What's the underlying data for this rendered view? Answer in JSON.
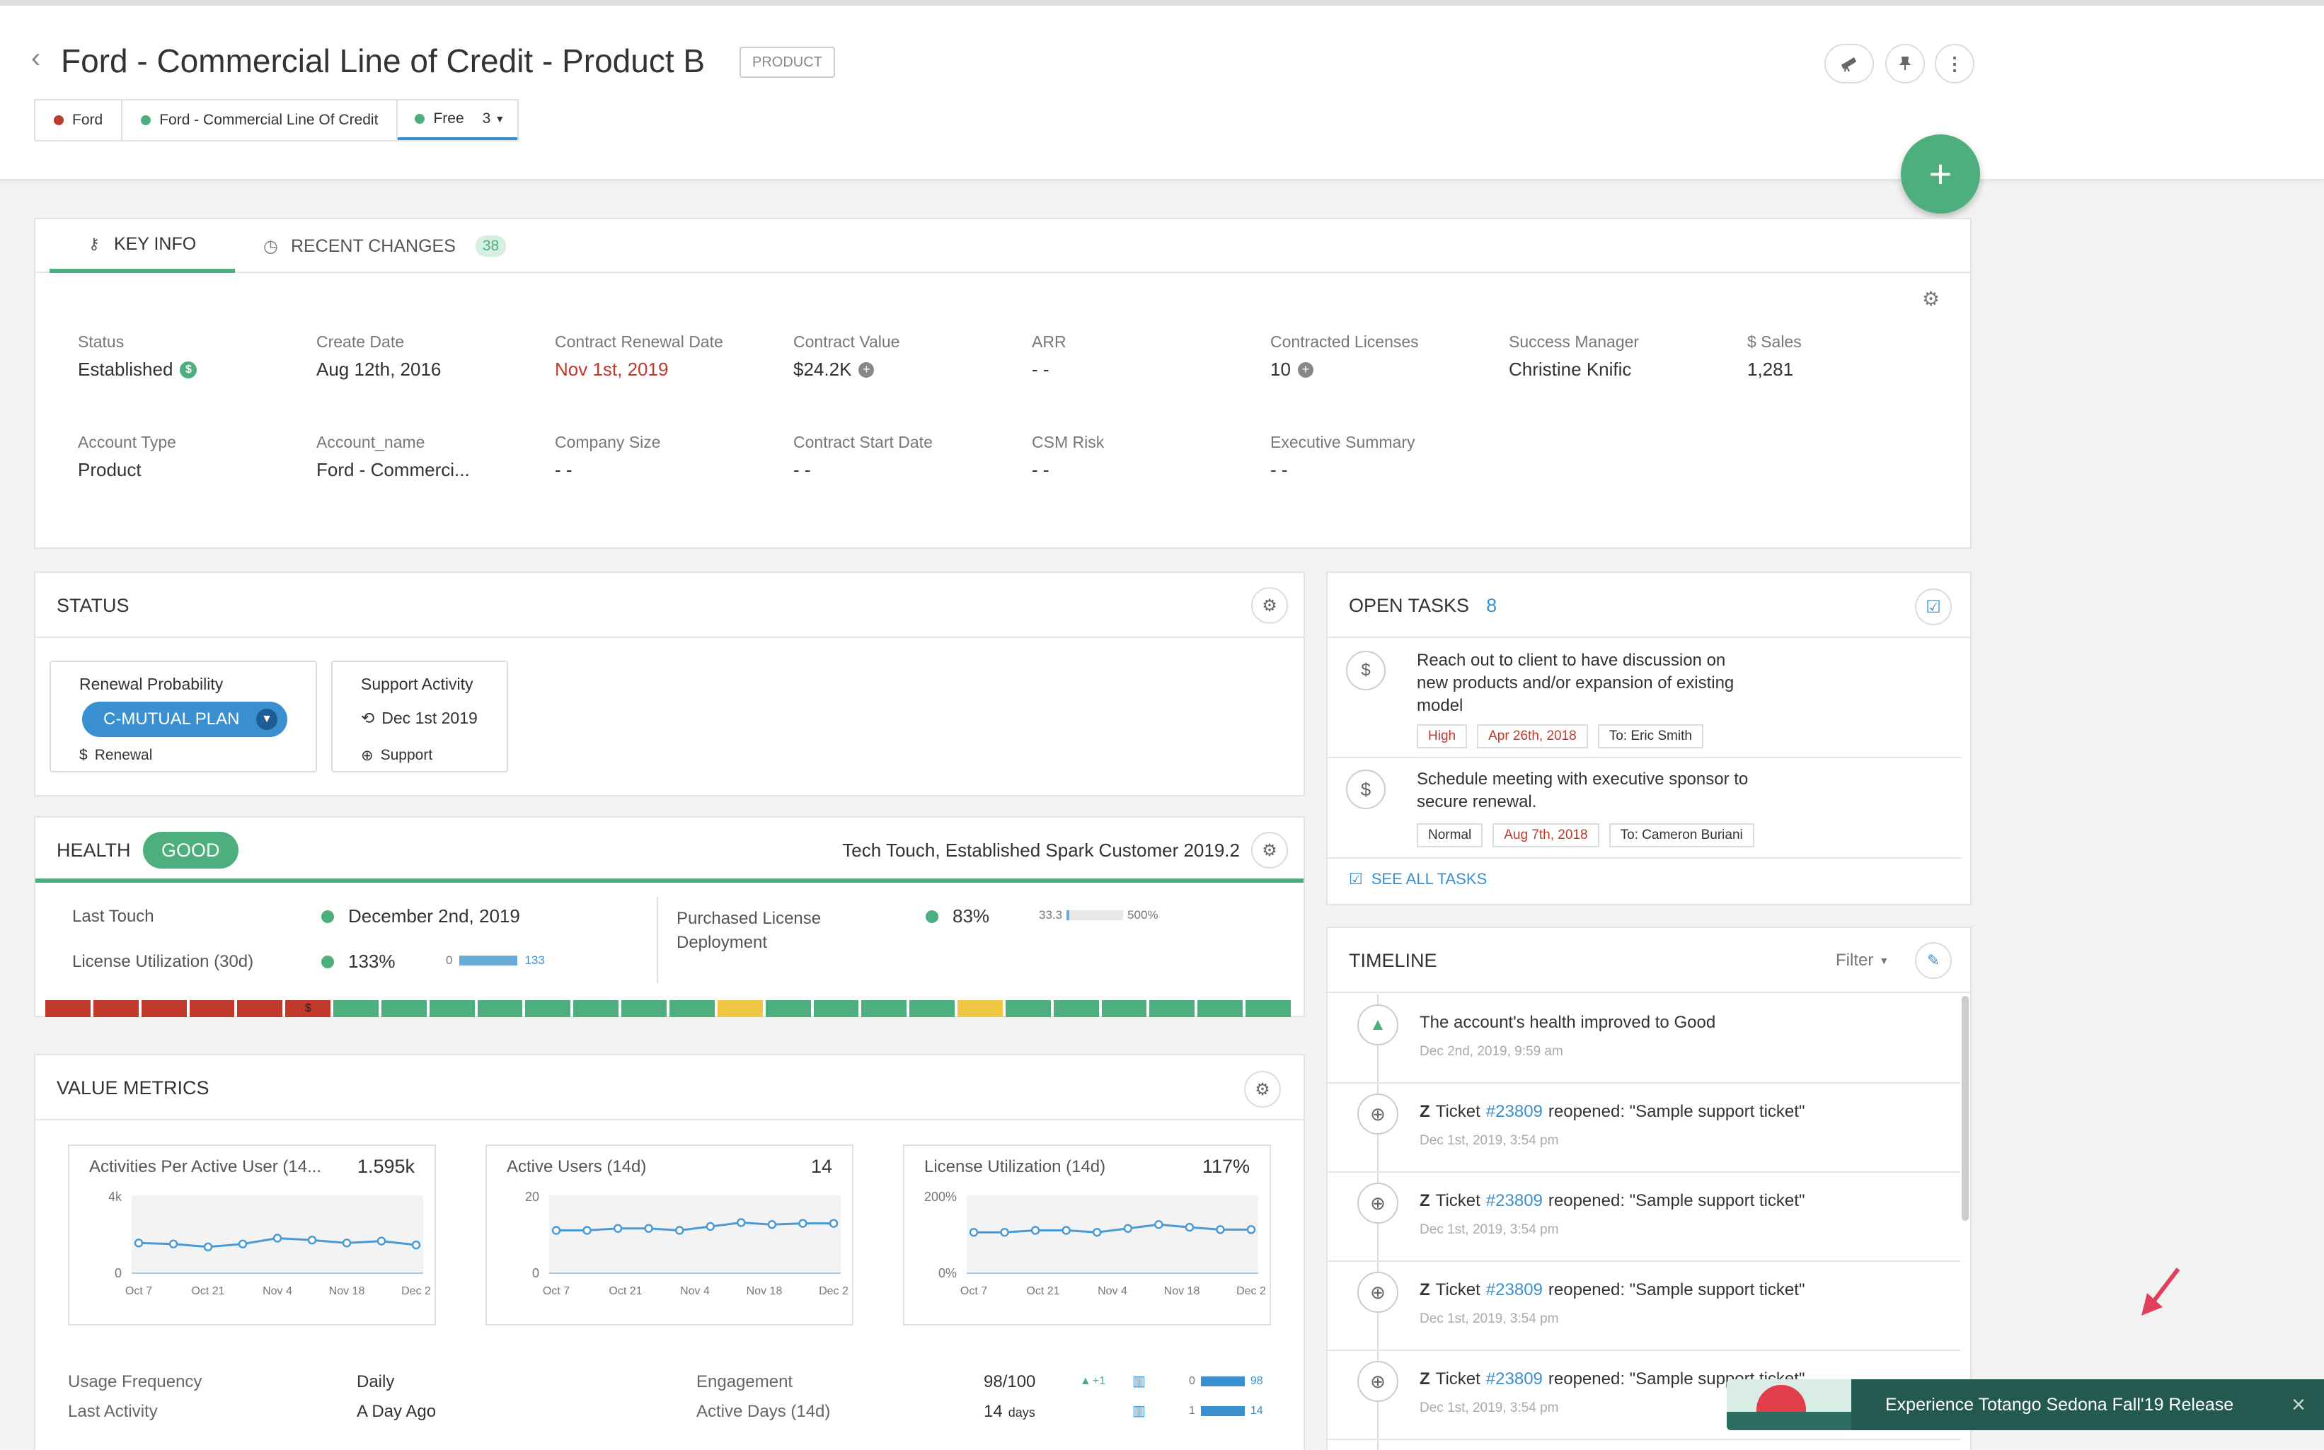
{
  "page": {
    "title": "Ford - Commercial Line of Credit - Product B",
    "type_badge": "PRODUCT",
    "breadcrumb": [
      {
        "label": "Ford",
        "color": "#b93d30"
      },
      {
        "label": "Ford - Commercial Line Of Credit",
        "color": "#4caf7d"
      },
      {
        "label": "Free",
        "color": "#4caf7d",
        "count": "3"
      }
    ]
  },
  "tabs": [
    {
      "label": "KEY INFO",
      "active": true
    },
    {
      "label": "RECENT CHANGES",
      "badge": "38"
    }
  ],
  "key_info": {
    "status": {
      "label": "Status",
      "value": "Established"
    },
    "create_date": {
      "label": "Create Date",
      "value": "Aug 12th, 2016"
    },
    "contract_renewal_date": {
      "label": "Contract Renewal Date",
      "value": "Nov 1st, 2019"
    },
    "contract_value": {
      "label": "Contract Value",
      "value": "$24.2K"
    },
    "arr": {
      "label": "ARR",
      "value": "- -"
    },
    "contracted_licenses": {
      "label": "Contracted Licenses",
      "value": "10"
    },
    "success_manager": {
      "label": "Success Manager",
      "value": "Christine Knific"
    },
    "sales": {
      "label": "$ Sales",
      "value": "1,281"
    },
    "account_type": {
      "label": "Account Type",
      "value": "Product"
    },
    "account_name": {
      "label": "Account_name",
      "value": "Ford - Commerci..."
    },
    "company_size": {
      "label": "Company Size",
      "value": "- -"
    },
    "contract_start_date": {
      "label": "Contract Start Date",
      "value": "- -"
    },
    "csm_risk": {
      "label": "CSM Risk",
      "value": "- -"
    },
    "executive_summary": {
      "label": "Executive Summary",
      "value": "- -"
    }
  },
  "status_card": {
    "title": "STATUS",
    "renewal": {
      "label": "Renewal Probability",
      "pill": "C-MUTUAL PLAN",
      "sub": "Renewal"
    },
    "support": {
      "label": "Support Activity",
      "date": "Dec 1st 2019",
      "sub": "Support"
    }
  },
  "health": {
    "title": "HEALTH",
    "badge": "GOOD",
    "profile": "Tech Touch, Established Spark Customer 2019.2",
    "last_touch": {
      "label": "Last Touch",
      "value": "December 2nd, 2019"
    },
    "license_util": {
      "label": "License Utilization (30d)",
      "value": "133%",
      "min": "0",
      "max": "133",
      "fill": 1.0
    },
    "purchased": {
      "label_1": "Purchased License",
      "label_2": "Deployment",
      "value": "83%",
      "min": "33.3",
      "max": "500%",
      "fill": 0.05
    },
    "bar_segments": [
      "r",
      "r",
      "r",
      "r",
      "r",
      "r",
      "g",
      "g",
      "g",
      "g",
      "g",
      "g",
      "g",
      "g",
      "y",
      "g",
      "g",
      "g",
      "g",
      "y",
      "g",
      "g",
      "g",
      "g",
      "g",
      "g"
    ],
    "bar_marker": "$",
    "colors": {
      "r": "#c0392b",
      "g": "#4caf7d",
      "y": "#f0c742"
    }
  },
  "value_metrics": {
    "title": "VALUE METRICS",
    "x_ticks": [
      "Oct 7",
      "Oct 21",
      "Nov 4",
      "Nov 18",
      "Dec 2"
    ],
    "charts": [
      {
        "title": "Activities Per Active User (14...",
        "value": "1.595k",
        "y_top": "4k",
        "y_bottom": "0"
      },
      {
        "title": "Active Users (14d)",
        "value": "14",
        "y_top": "20",
        "y_bottom": "0"
      },
      {
        "title": "License Utilization (14d)",
        "value": "117%",
        "y_top": "200%",
        "y_bottom": "0%"
      }
    ],
    "usage_frequency": {
      "label": "Usage Frequency",
      "value": "Daily"
    },
    "last_activity": {
      "label": "Last Activity",
      "value": "A Day Ago"
    },
    "engagement": {
      "label": "Engagement",
      "value": "98/100",
      "delta": "+1",
      "min": "0",
      "max": "98"
    },
    "active_days": {
      "label": "Active Days (14d)",
      "value": "14",
      "unit": "days",
      "min": "1",
      "max": "14"
    }
  },
  "chart_data": [
    {
      "type": "line",
      "title": "Activities Per Active User (14...",
      "x": [
        "Oct 7",
        "",
        "Oct 21",
        "",
        "Nov 4",
        "",
        "Nov 18",
        "",
        "Dec 2"
      ],
      "values": [
        1.55,
        1.5,
        1.35,
        1.5,
        1.8,
        1.7,
        1.55,
        1.65,
        1.45
      ],
      "ylim": [
        0,
        4
      ]
    },
    {
      "type": "line",
      "title": "Active Users (14d)",
      "x": [
        "Oct 7",
        "",
        "",
        "",
        "",
        "",
        "",
        "",
        "",
        ""
      ],
      "values": [
        11,
        11,
        11.5,
        11.5,
        11,
        12,
        13,
        12.5,
        12.8,
        12.8
      ],
      "ylim": [
        0,
        20
      ]
    },
    {
      "type": "line",
      "title": "License Utilization (14d)",
      "x": [
        "Oct 7",
        "",
        "",
        "",
        "",
        "",
        "",
        "",
        "",
        ""
      ],
      "values": [
        105,
        105,
        110,
        110,
        105,
        115,
        125,
        118,
        112,
        112
      ],
      "ylim": [
        0,
        200
      ]
    }
  ],
  "open_tasks": {
    "title": "OPEN TASKS",
    "count": "8",
    "items": [
      {
        "text_1": "Reach out to client to have discussion on",
        "text_2": "new products and/or expansion of existing",
        "text_3": "model",
        "priority": "High",
        "due": "Apr 26th, 2018",
        "to": "To: Eric Smith"
      },
      {
        "text_1": "Schedule meeting with executive sponsor to",
        "text_2": "secure renewal.",
        "text_3": "",
        "priority": "Normal",
        "due": "Aug 7th, 2018",
        "to": "To: Cameron Buriani"
      }
    ],
    "see_all": "SEE ALL TASKS"
  },
  "timeline": {
    "title": "TIMELINE",
    "filter": "Filter",
    "items": [
      {
        "kind": "health",
        "text": "The account's health improved to Good",
        "time": "Dec 2nd, 2019, 9:59 am"
      },
      {
        "kind": "ticket",
        "prefix": "Ticket",
        "ticket": "#23809",
        "text": "reopened: \"Sample support ticket\"",
        "time": "Dec 1st, 2019, 3:54 pm"
      },
      {
        "kind": "ticket",
        "prefix": "Ticket",
        "ticket": "#23809",
        "text": "reopened: \"Sample support ticket\"",
        "time": "Dec 1st, 2019, 3:54 pm"
      },
      {
        "kind": "ticket",
        "prefix": "Ticket",
        "ticket": "#23809",
        "text": "reopened: \"Sample support ticket\"",
        "time": "Dec 1st, 2019, 3:54 pm"
      },
      {
        "kind": "ticket",
        "prefix": "Ticket",
        "ticket": "#23809",
        "text": "reopened: \"Sample support ticket\"",
        "time": "Dec 1st, 2019, 3:54 pm"
      }
    ]
  },
  "promo": {
    "text": "Experience Totango Sedona Fall'19 Release"
  },
  "colors": {
    "accent": "#4caf7d",
    "link": "#3a8fd1",
    "danger": "#c0392b",
    "pill": "#3a8fd1"
  }
}
